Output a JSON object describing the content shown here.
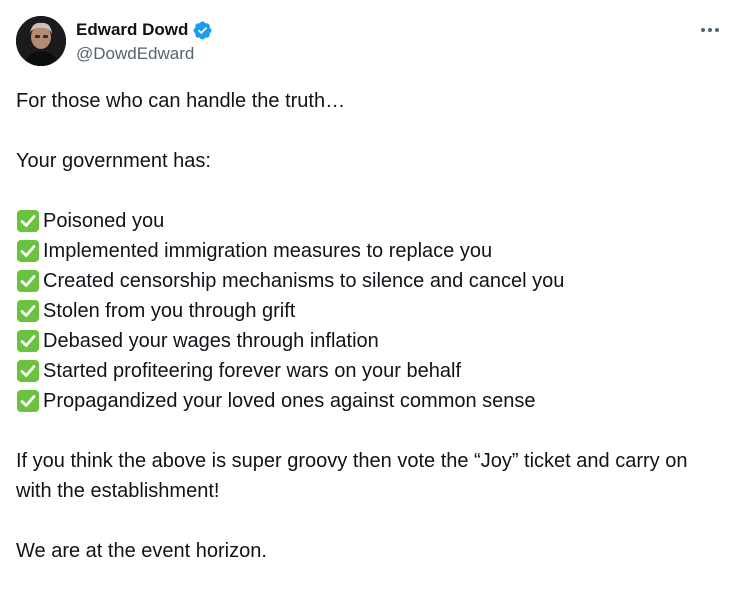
{
  "author": {
    "display_name": "Edward Dowd",
    "handle": "@DowdEdward",
    "verified": true
  },
  "more_label": "•••",
  "tweet": {
    "intro": "For those who can handle the truth…",
    "lead": "Your government has:",
    "checklist": [
      "Poisoned you",
      "Implemented immigration measures to replace you",
      "Created censorship mechanisms to silence and cancel you",
      "Stolen from you through grift",
      "Debased your wages through inflation",
      "Started profiteering forever wars on your behalf",
      "Propagandized your loved ones against common sense"
    ],
    "closing": "If you think the above is super groovy then vote the “Joy” ticket and carry on with the establishment!",
    "final": "We are at the event horizon."
  },
  "colors": {
    "verified_blue": "#1d9bf0",
    "check_green": "#6ac23f",
    "handle_gray": "#536471",
    "text": "#0f1419"
  },
  "icons": {
    "verified": "verified-badge-icon",
    "more": "more-options-icon",
    "check": "check-mark-button-icon"
  }
}
